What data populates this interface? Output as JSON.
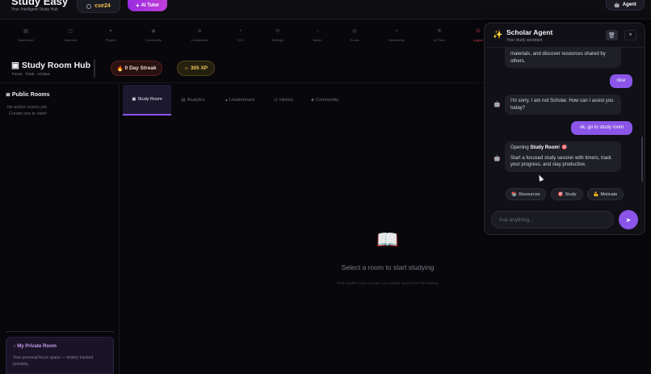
{
  "app": {
    "title": "Study Easy",
    "subtitle": "Your Intelligent Study Hub",
    "user_chip": "cse24",
    "ai_tutor_button": "AI Tutor",
    "agent_button": "Agent"
  },
  "nav": [
    {
      "label": "Dashboard",
      "icon": "grid-icon",
      "glyph": "▦"
    },
    {
      "label": "Calendar",
      "icon": "calendar-icon",
      "glyph": "◫"
    },
    {
      "label": "Plugins",
      "icon": "puzzle-icon",
      "glyph": "✦"
    },
    {
      "label": "Community",
      "icon": "community-icon",
      "glyph": "◉"
    },
    {
      "label": "Collabsoats",
      "icon": "collab-icon",
      "glyph": "⊕"
    },
    {
      "label": "ECX",
      "icon": "plus-icon",
      "glyph": "+"
    },
    {
      "label": "Settings",
      "icon": "gear-icon",
      "glyph": "⚙"
    },
    {
      "label": "Admin",
      "icon": "admin-icon",
      "glyph": "○"
    },
    {
      "label": "Social",
      "icon": "social-icon",
      "glyph": "◍"
    },
    {
      "label": "Marketship",
      "icon": "market-icon",
      "glyph": "✧"
    },
    {
      "label": "AI Tutor",
      "icon": "ai-icon",
      "glyph": "❋"
    },
    {
      "label": "Logout",
      "icon": "power-icon",
      "glyph": "⏻"
    }
  ],
  "hub": {
    "title": "Study Room Hub",
    "subtitle": "Focus · Track · Achieve",
    "streak": "0 Day Streak",
    "xp": "305 XP"
  },
  "sidebar": {
    "title": "Public Rooms",
    "empty_line1": "No active rooms yet.",
    "empty_line2": "Create one to start!",
    "private_title": "My Private Room",
    "private_desc": "Your personal focus space — history tracked privately."
  },
  "tabs": [
    {
      "label": "Study Room",
      "glyph": "▣",
      "active": true
    },
    {
      "label": "Analytics",
      "glyph": "▤",
      "active": false
    },
    {
      "label": "Leaderboard",
      "glyph": "▴",
      "active": false
    },
    {
      "label": "History",
      "glyph": "◷",
      "active": false
    },
    {
      "label": "Community",
      "glyph": "◈",
      "active": false
    }
  ],
  "main": {
    "book_icon": "📖",
    "message": "Select a room to start studying",
    "submessage": "Pick a public room or enter your private space from the sidebar"
  },
  "agent": {
    "name": "Scholar Agent",
    "role": "Your study assistant",
    "trash_glyph": "🗑",
    "close_glyph": "×",
    "messages": [
      {
        "from": "bot",
        "text": "materials, and discover resources shared by others."
      },
      {
        "from": "user",
        "text": "nice"
      },
      {
        "from": "bot",
        "text": "I'm sorry, I am not Scholar. How can I assist you today?"
      },
      {
        "from": "user",
        "text": "ok, go to study room"
      },
      {
        "from": "bot",
        "lead": "Opening ",
        "bold": "Study Room",
        "tail": "! 🎯",
        "body": "Start a focused study session with timers, track your progress, and stay productive."
      }
    ],
    "quick_replies": [
      {
        "label": "Resources",
        "glyph": "📚"
      },
      {
        "label": "Study",
        "glyph": "🎯"
      },
      {
        "label": "Motivate",
        "glyph": "💪"
      }
    ],
    "input_placeholder": "Ask anything...",
    "send_glyph": "➤"
  }
}
